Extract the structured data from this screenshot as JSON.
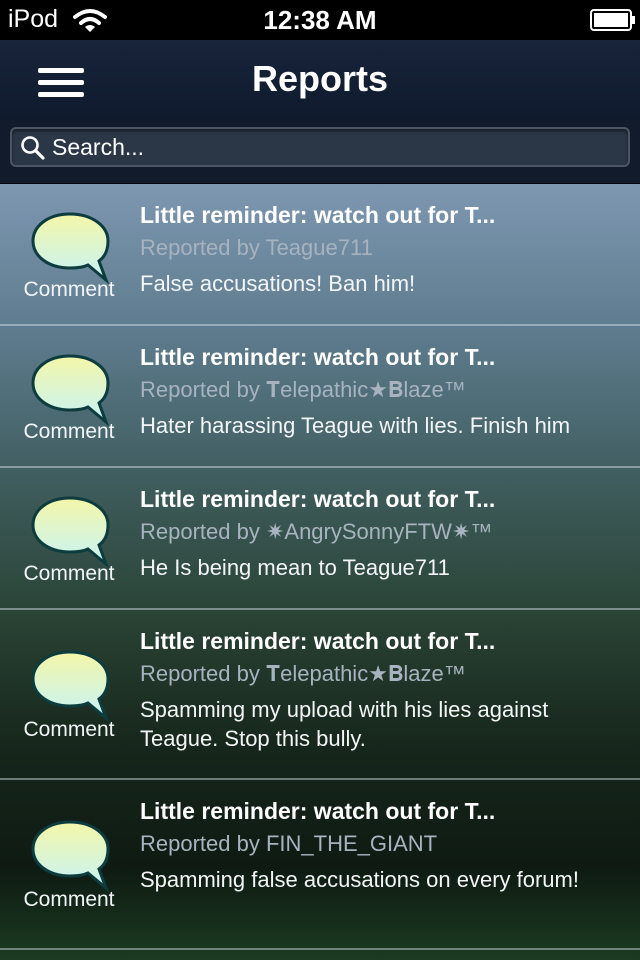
{
  "status_bar": {
    "device": "iPod",
    "time": "12:38 AM"
  },
  "nav": {
    "title": "Reports",
    "menu_icon": "hamburger-menu-icon"
  },
  "search": {
    "placeholder": "Search..."
  },
  "reports": [
    {
      "type": "Comment",
      "title": "Little reminder: watch out for T...",
      "reporter_line": "Reported by Teague711",
      "reason": "False accusations! Ban him!"
    },
    {
      "type": "Comment",
      "title": "Little reminder: watch out for T...",
      "reporter_line": "Reported by 𝐓elepathic★𝐁laze™",
      "reason": "Hater harassing Teague with lies. Finish him"
    },
    {
      "type": "Comment",
      "title": "Little reminder: watch out for T...",
      "reporter_line": "Reported by ✷AngrySonnyFTW✷™",
      "reason": "He Is being mean to Teague711"
    },
    {
      "type": "Comment",
      "title": "Little reminder: watch out for T...",
      "reporter_line": "Reported by 𝐓elepathic★𝐁laze™",
      "reason": "Spamming my upload with his lies against Teague. Stop this bully."
    },
    {
      "type": "Comment",
      "title": "Little reminder: watch out for T...",
      "reporter_line": "Reported by FIN_THE_GIANT",
      "reason": "Spamming false accusations on every forum!"
    }
  ],
  "colors": {
    "nav_background": "#16223a",
    "bubble_fill_top": "#f3f6a8",
    "bubble_fill_bottom": "#c8f4f6",
    "row_divider": "#c8d2dc"
  }
}
